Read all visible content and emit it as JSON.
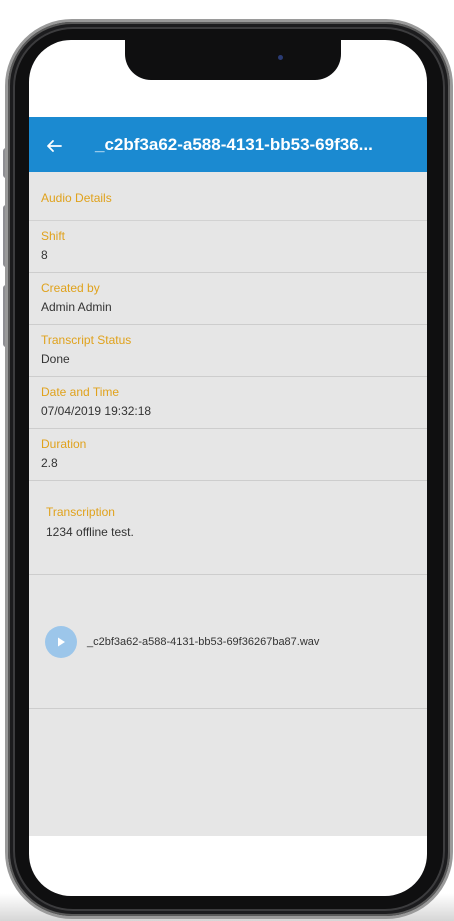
{
  "appbar": {
    "title": "_c2bf3a62-a588-4131-bb53-69f36..."
  },
  "details": {
    "section_title": "Audio Details",
    "fields": [
      {
        "label": "Shift",
        "value": "8"
      },
      {
        "label": "Created by",
        "value": "Admin Admin"
      },
      {
        "label": "Transcript Status",
        "value": "Done"
      },
      {
        "label": "Date and Time",
        "value": "07/04/2019 19:32:18"
      },
      {
        "label": "Duration",
        "value": "2.8"
      }
    ],
    "transcription": {
      "label": "Transcription",
      "value": "1234 offline test."
    }
  },
  "audio": {
    "filename": "_c2bf3a62-a588-4131-bb53-69f36267ba87.wav"
  },
  "colors": {
    "appbar": "#1b8ad1",
    "label": "#e0a21c",
    "content_bg": "#e6e6e6",
    "play_button": "#9cc6ea"
  },
  "icons": {
    "back": "arrow-left-icon",
    "play": "play-icon"
  }
}
